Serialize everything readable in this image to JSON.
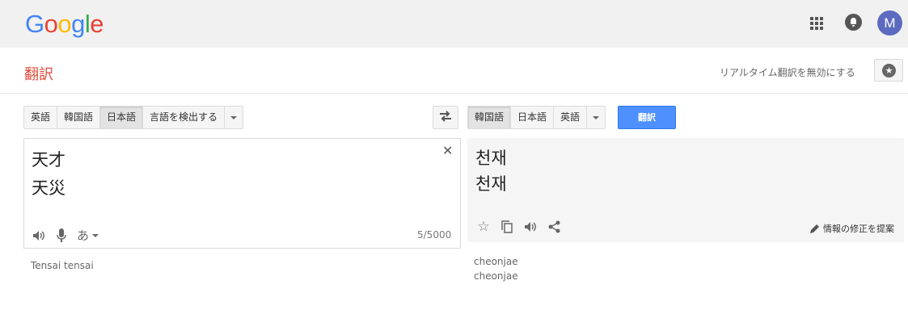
{
  "app": {
    "logo_letters": [
      "G",
      "o",
      "o",
      "g",
      "l",
      "e"
    ],
    "logo_colors": [
      "#4285f4",
      "#ea4335",
      "#fbbc05",
      "#4285f4",
      "#34a853",
      "#ea4335"
    ],
    "avatar_initial": "M"
  },
  "header": {
    "title": "翻訳",
    "instant_link": "リアルタイム翻訳を無効にする"
  },
  "source": {
    "languages": [
      "英語",
      "韓国語",
      "日本語",
      "言語を検出する"
    ],
    "selected_index": 2,
    "text": "天才\n天災",
    "char_count": "5/5000",
    "input_method_label": "あ",
    "romanization": "Tensai tensai"
  },
  "target": {
    "languages": [
      "韓国語",
      "日本語",
      "英語"
    ],
    "selected_index": 0,
    "text": "천재\n천재",
    "romanization": "cheonjae\ncheonjae",
    "suggest_edit_label": "情報の修正を提案"
  },
  "translate_button": "翻訳",
  "colors": {
    "accent": "#4d90fe",
    "title": "#dd4b39",
    "avatar": "#5c6bc0"
  }
}
